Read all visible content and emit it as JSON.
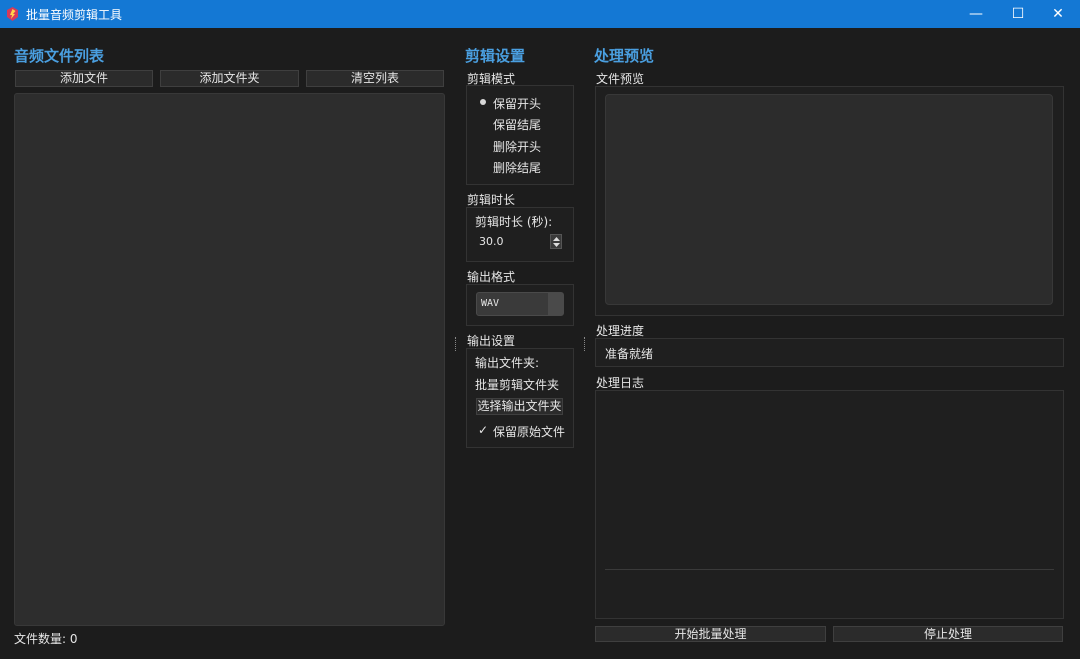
{
  "window": {
    "title": "批量音频剪辑工具",
    "controls": {
      "minimize": "—",
      "maximize": "☐",
      "close": "✕"
    }
  },
  "file_list": {
    "title": "音频文件列表",
    "add_file": "添加文件",
    "add_folder": "添加文件夹",
    "clear_list": "清空列表",
    "count_label": "文件数量: 0"
  },
  "clip_settings": {
    "title": "剪辑设置",
    "mode_group": "剪辑模式",
    "modes": [
      "保留开头",
      "保留结尾",
      "删除开头",
      "删除结尾"
    ],
    "selected_mode": 0,
    "duration_group": "剪辑时长",
    "duration_label": "剪辑时长 (秒):",
    "duration_value": "30.0",
    "format_group": "输出格式",
    "format_value": "WAV",
    "output_group": "输出设置",
    "output_folder_label": "输出文件夹:",
    "output_folder_value": "批量剪辑文件夹",
    "select_folder": "选择输出文件夹",
    "keep_original": "保留原始文件",
    "keep_original_checked": true
  },
  "preview": {
    "title": "处理预览",
    "file_preview": "文件预览",
    "progress_group": "处理进度",
    "progress_status": "准备就绪",
    "progress_value": 0,
    "log_group": "处理日志",
    "start": "开始批量处理",
    "stop": "停止处理"
  },
  "colors": {
    "accent": "#4a9fe0",
    "titlebar": "#1478d4",
    "background": "#1c1c1c"
  }
}
